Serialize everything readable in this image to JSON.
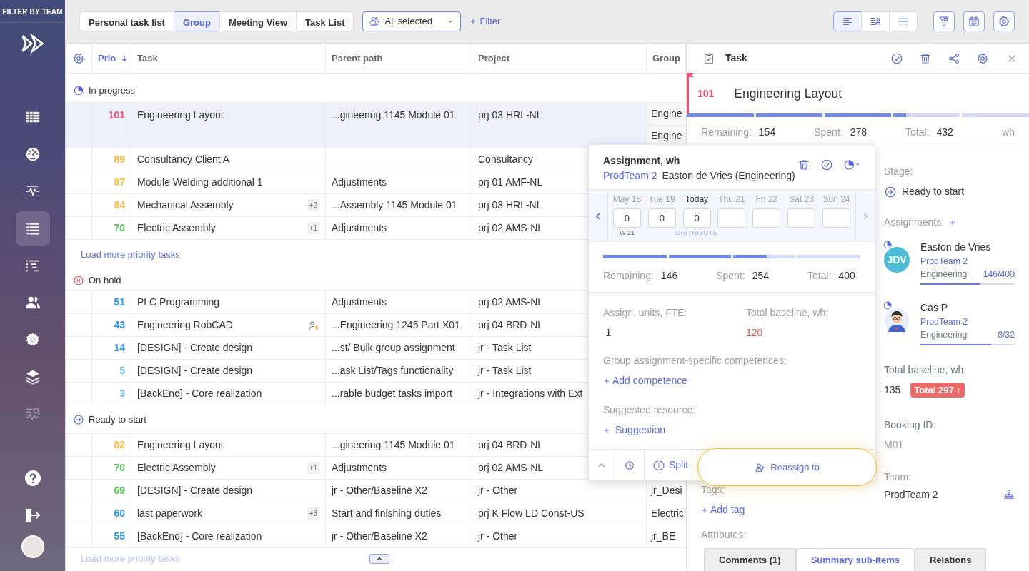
{
  "sidebar": {
    "title": "FILTER BY TEAM",
    "items": [
      {
        "selected": false,
        "disabled": false
      },
      {
        "selected": false,
        "disabled": false
      },
      {
        "selected": false,
        "disabled": false
      },
      {
        "selected": true,
        "disabled": false
      },
      {
        "selected": false,
        "disabled": false
      },
      {
        "selected": false,
        "disabled": false
      },
      {
        "selected": false,
        "disabled": false
      },
      {
        "selected": false,
        "disabled": false
      },
      {
        "selected": false,
        "disabled": true
      }
    ]
  },
  "toolbar": {
    "view_tabs": [
      {
        "label": "Personal task list",
        "selected": false
      },
      {
        "label": "Group",
        "selected": true
      },
      {
        "label": "Meeting View",
        "selected": false
      },
      {
        "label": "Task List",
        "selected": false
      }
    ],
    "team_select": {
      "value": "All selected"
    },
    "filter_link": "Filter",
    "layout_buttons": [
      {
        "selected": true
      },
      {
        "selected": false
      },
      {
        "selected": false
      }
    ]
  },
  "table": {
    "columns": [
      {
        "label": "Prio",
        "sorted": true
      },
      {
        "label": "Task",
        "sorted": false
      },
      {
        "label": "Parent path",
        "sorted": false
      },
      {
        "label": "Project",
        "sorted": false
      },
      {
        "label": "Group",
        "sorted": false
      }
    ],
    "groups": [
      {
        "stage": "In progress",
        "kind": "in_progress",
        "load_more": "Load more priority tasks",
        "rows": [
          {
            "prio": "101",
            "color": "#f0506e",
            "task": "Engineering Layout",
            "parent": "...gineering 1145 Module 01",
            "project": "prj 03 HRL-NL",
            "groups": [
              "Engine",
              "Engine"
            ],
            "selected": true,
            "cost_icon": false
          },
          {
            "prio": "89",
            "color": "#f5b942",
            "task": "Consultancy Client A",
            "project": "Consultancy",
            "selected": false,
            "cost_icon": false
          },
          {
            "prio": "87",
            "color": "#f5b942",
            "task": "Module Welding additional 1",
            "parent": "Adjustments",
            "project": "prj 01 AMF-NL",
            "selected": false,
            "cost_icon": false
          },
          {
            "prio": "84",
            "color": "#f5b942",
            "task": "Mechanical Assembly",
            "badge": "+2",
            "parent": "...Assembly 1145 Module 01",
            "project": "prj 03 HRL-NL",
            "selected": false,
            "cost_icon": false
          },
          {
            "prio": "70",
            "color": "#58c458",
            "task": "Electric Assembly",
            "badge": "+1",
            "parent": "Adjustments",
            "project": "prj 02 AMS-NL",
            "selected": false,
            "cost_icon": false
          }
        ]
      },
      {
        "stage": "On hold",
        "kind": "on_hold",
        "rows": [
          {
            "prio": "51",
            "color": "#2e98e6",
            "task": "PLC Programming",
            "parent": "Adjustments",
            "project": "prj 02 AMS-NL",
            "selected": false,
            "cost_icon": false
          },
          {
            "prio": "43",
            "color": "#2e98e6",
            "task": "Engineering RobCAD",
            "parent": "...Engineering 1245 Part X01",
            "project": "prj 04 BRD-NL",
            "selected": false,
            "cost_icon": true
          },
          {
            "prio": "14",
            "color": "#2e98e6",
            "task": "[DESIGN] - Create design",
            "parent": "...st/ Bulk group assignment",
            "project": "jr - Task List",
            "selected": false,
            "cost_icon": false
          },
          {
            "prio": "5",
            "color": "#6cbcf0",
            "task": "[DESIGN] - Create design",
            "parent": "...ask List/Tags functionality",
            "project": "jr - Task List",
            "selected": false,
            "cost_icon": false
          },
          {
            "prio": "3",
            "color": "#6cbcf0",
            "task": "[BackEnd] - Core realization",
            "parent": "...rable budget tasks import",
            "project": "jr - Integrations with Ext",
            "selected": false,
            "cost_icon": false
          }
        ]
      },
      {
        "stage": "Ready to start",
        "kind": "ready",
        "load_more": "Load more priority tasks",
        "rows": [
          {
            "prio": "82",
            "color": "#f5b942",
            "task": "Engineering Layout",
            "parent": "...gineering 1145 Module 01",
            "project": "prj 04 BRD-NL",
            "selected": false,
            "cost_icon": false
          },
          {
            "prio": "70",
            "color": "#58c458",
            "task": "Electric Assembly",
            "badge": "+1",
            "parent": "Adjustments",
            "project": "prj 02 AMS-NL",
            "selected": false,
            "cost_icon": false
          },
          {
            "prio": "69",
            "color": "#58c458",
            "task": "[DESIGN] - Create design",
            "parent": "jr - Other/Baseline X2",
            "project": "jr - Other",
            "groups": [
              "jr_Desi"
            ],
            "selected": false,
            "cost_icon": false
          },
          {
            "prio": "60",
            "color": "#2e98e6",
            "task": "last paperwork",
            "badge": "+3",
            "parent": "Start and finishing duties",
            "project": "prj K Flow LD Const-US",
            "groups": [
              "Electric"
            ],
            "selected": false,
            "cost_icon": false
          },
          {
            "prio": "55",
            "color": "#2e98e6",
            "task": "[BackEnd] - Core realization",
            "parent": "jr - Other/Baseline X2",
            "project": "jr - Other",
            "groups": [
              "jr_BE"
            ],
            "selected": false,
            "cost_icon": false
          }
        ]
      }
    ]
  },
  "task_panel": {
    "title": "Task",
    "prio": "101",
    "name": "Engineering Layout",
    "flag": true,
    "level": 0.64,
    "stats": [
      {
        "label": "Remaining:",
        "value": "154"
      },
      {
        "label": "Spent:",
        "value": "278"
      },
      {
        "label": "Total:",
        "value": "432"
      }
    ],
    "unit": "wh",
    "stage": {
      "label": "Stage:",
      "value": "Ready to start"
    },
    "assignments": {
      "label": "Assignments:",
      "people": [
        {
          "name": "Easton de Vries",
          "team": "ProdTeam 2",
          "dept": "Engineering",
          "hours": "146/400",
          "level": 0.63,
          "kind": "initials",
          "initials": "JDV"
        },
        {
          "name": "Cas P",
          "team": "ProdTeam 2",
          "dept": "Engineering",
          "hours": "8/32",
          "level": 0.75,
          "kind": "cartoon"
        }
      ]
    },
    "baseline": {
      "label": "Total baseline, wh:",
      "value": "135",
      "badge": "Total 297 ↑"
    },
    "booking": {
      "label": "Booking ID:",
      "value": "M01"
    },
    "team": {
      "label": "Team:",
      "value": "ProdTeam 2"
    },
    "tags": {
      "label": "Tags:",
      "add": "Add tag"
    },
    "attributes_label": "Attributes:",
    "tabs": [
      {
        "label": "Comments (1)",
        "selected": false
      },
      {
        "label": "Summary sub-items",
        "selected": true
      },
      {
        "label": "Relations",
        "selected": false
      }
    ]
  },
  "assignment_popup": {
    "title": "Assignment, wh",
    "team": "ProdTeam 2",
    "person": "Easton de Vries (Engineering)",
    "days": [
      {
        "label": "May 18",
        "value": "0",
        "today": false,
        "week": "W 21"
      },
      {
        "label": "Tue 19",
        "value": "0",
        "today": false
      },
      {
        "label": "Today",
        "value": "0",
        "today": true,
        "action": "DISTRIBUTE"
      },
      {
        "label": "Thu 21",
        "today": false
      },
      {
        "label": "Fri 22",
        "today": false
      },
      {
        "label": "Sat 23",
        "today": false
      },
      {
        "label": "Sun 24",
        "today": false
      }
    ],
    "level": 0.635,
    "stats": [
      {
        "label": "Remaining:",
        "value": "146"
      },
      {
        "label": "Spent:",
        "value": "254"
      },
      {
        "label": "Total:",
        "value": "400"
      }
    ],
    "units": {
      "label": "Assign. units, FTE:",
      "value": "1"
    },
    "baseline": {
      "label": "Total baseline, wh:",
      "value": "120"
    },
    "competences": {
      "label": "Group assignment-specific competences:",
      "add": "Add competence"
    },
    "suggested": {
      "label": "Suggested resource:",
      "add": "Suggestion"
    },
    "split": "Split",
    "reassign": {
      "label": "Reassign to",
      "highlighted": true
    }
  }
}
